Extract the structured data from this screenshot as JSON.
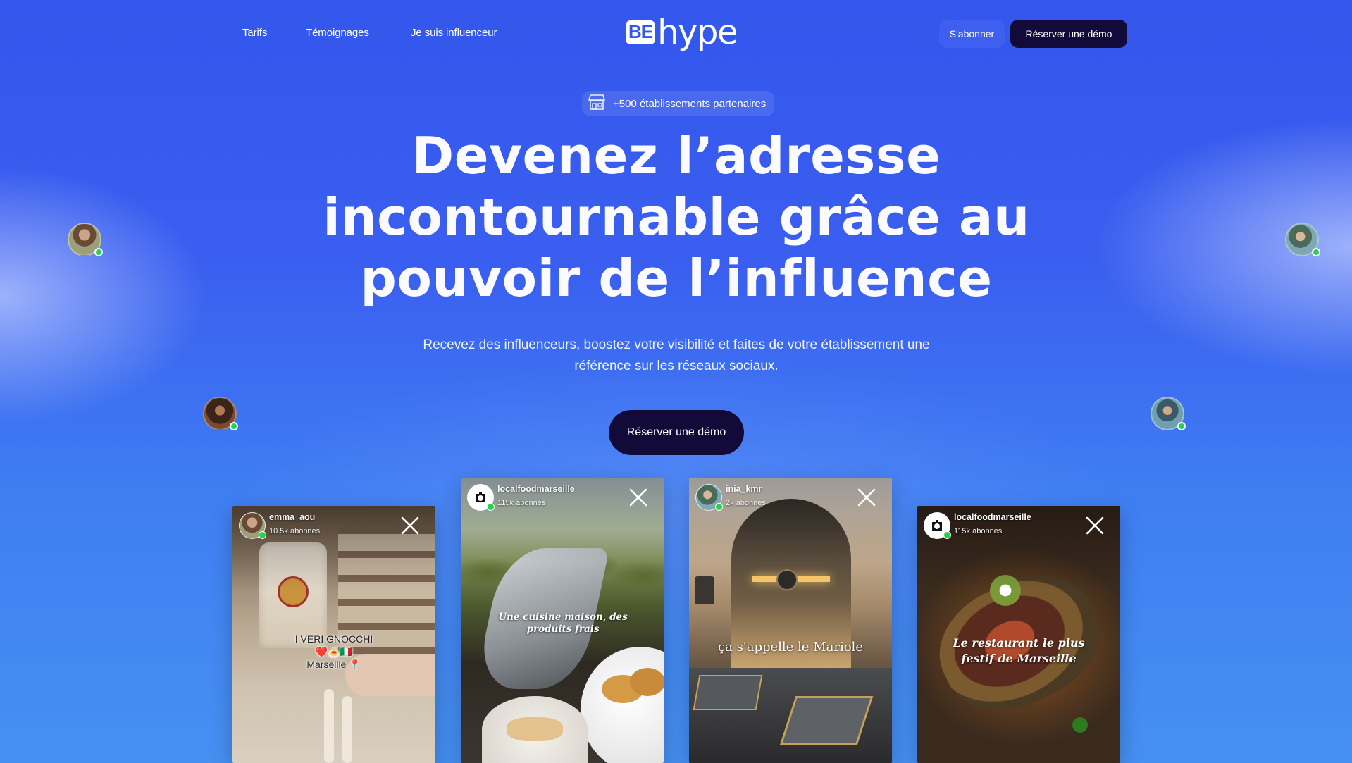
{
  "nav": {
    "links": [
      "Tarifs",
      "Témoignages",
      "Je suis influenceur"
    ],
    "logo_box": "BE",
    "logo_text": "hype",
    "subscribe_label": "S'abonner",
    "demo_label": "Réserver une démo"
  },
  "hero": {
    "badge_icon": "storefront-icon",
    "badge_text": "+500 établissements partenaires",
    "headline_lines": [
      "Devenez l’adresse",
      "incontournable grâce au",
      "pouvoir de l’influence"
    ],
    "subtitle": "Recevez des influenceurs, boostez votre visibilité et faites de votre établissement une référence sur les réseaux sociaux.",
    "cta_label": "Réserver une démo"
  },
  "floating_avatars": [
    {
      "side": "left-top",
      "status": "online"
    },
    {
      "side": "left-bottom",
      "status": "online"
    },
    {
      "side": "right-top",
      "status": "online"
    },
    {
      "side": "right-bottom",
      "status": "online"
    }
  ],
  "reels": [
    {
      "username": "emma_aou",
      "subscribers": "10.5k abonnés",
      "caption": "I VERI GNOCCHI\n❤️🍝🇮🇹\nMarseille 📍",
      "close_icon": "close-icon"
    },
    {
      "username": "localfoodmarseille",
      "subscribers": "115k abonnés",
      "caption": "Une cuisine maison, des produits frais",
      "close_icon": "close-icon"
    },
    {
      "username": "inia_kmr",
      "subscribers": "2k abonnés",
      "caption": "ça s'appelle le Mariole",
      "close_icon": "close-icon"
    },
    {
      "username": "localfoodmarseille",
      "subscribers": "115k abonnés",
      "caption": "Le restaurant le plus festif de Marseille",
      "close_icon": "close-icon"
    }
  ],
  "colors": {
    "primary_blue": "#3356ec",
    "dark_button": "#120b3a",
    "online_green": "#22d44a"
  }
}
